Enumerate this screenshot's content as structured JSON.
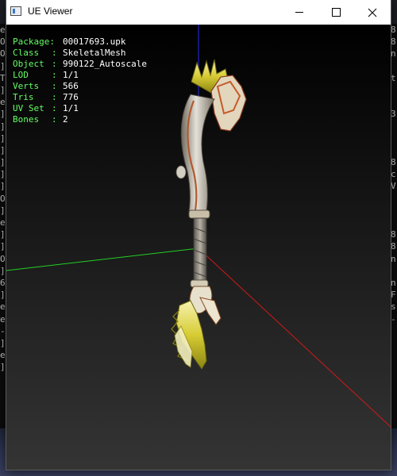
{
  "window": {
    "title": "UE Viewer",
    "icon": "app-window-icon"
  },
  "info": {
    "package_label": "Package:",
    "package_value": "00017693.upk",
    "class_label": "Class",
    "class_value": "SkeletalMesh",
    "object_label": "Object",
    "object_value": "990122_Autoscale",
    "lod_label": "LOD",
    "lod_value": "1/1",
    "verts_label": "Verts",
    "verts_value": "566",
    "tris_label": "Tris",
    "tris_value": "776",
    "uvset_label": "UV Set",
    "uvset_value": "1/1",
    "bones_label": "Bones",
    "bones_value": "2",
    "separator": ":"
  },
  "background_console": {
    "left_chars": [
      "e",
      "O",
      "O",
      "]",
      "T",
      "]",
      "e",
      "]",
      "]",
      "]",
      "]",
      "]",
      "]",
      "]",
      "O",
      "]",
      "e",
      "]",
      "]",
      "O",
      "]",
      "6",
      "]",
      "e",
      "e",
      "-",
      "]",
      "e",
      "]"
    ],
    "right_chars": [
      "8",
      "8",
      "n",
      "",
      "t",
      "",
      "",
      "3",
      "",
      "",
      "",
      "8",
      "c",
      "V",
      "",
      "",
      "",
      "8",
      "8",
      "n",
      "",
      "n",
      "F",
      "s",
      "-"
    ]
  },
  "colors": {
    "overlay_label": "#63ff63",
    "overlay_value": "#ffffff",
    "axis_x": "#d01a1a",
    "axis_y": "#22d022",
    "axis_z": "#2a2aee"
  },
  "scene_object": "scepter-mesh"
}
